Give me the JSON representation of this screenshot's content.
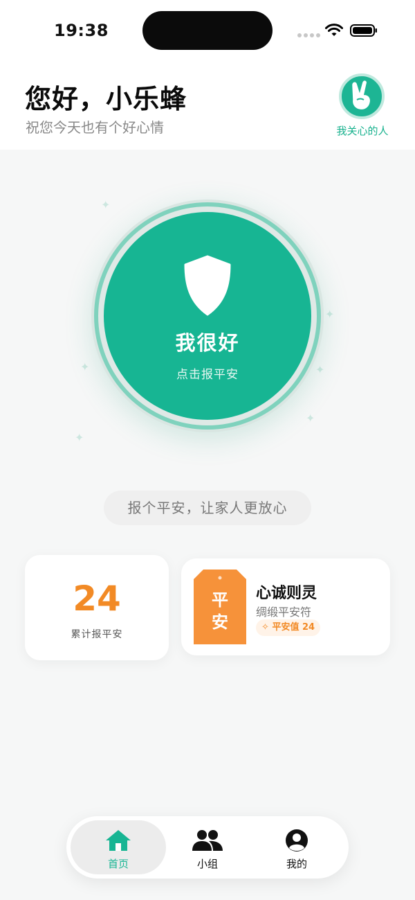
{
  "status_bar": {
    "time": "19:38"
  },
  "header": {
    "greeting": "您好，小乐蜂",
    "subtitle": "祝您今天也有个好心情",
    "care_label": "我关心的人"
  },
  "checkin": {
    "title": "我很好",
    "subtitle": "点击报平安"
  },
  "tip": "报个平安，让家人更放心",
  "stats": {
    "count": "24",
    "label": "累计报平安"
  },
  "amulet": {
    "tag_chars": [
      "平",
      "安"
    ],
    "title": "心诚则灵",
    "subtitle": "绸缎平安符",
    "badge": "平安值 24"
  },
  "tabs": [
    {
      "label": "首页",
      "icon": "home-icon",
      "active": true
    },
    {
      "label": "小组",
      "icon": "group-icon",
      "active": false
    },
    {
      "label": "我的",
      "icon": "profile-icon",
      "active": false
    }
  ],
  "colors": {
    "accent": "#17b593",
    "orange": "#f28a25"
  }
}
